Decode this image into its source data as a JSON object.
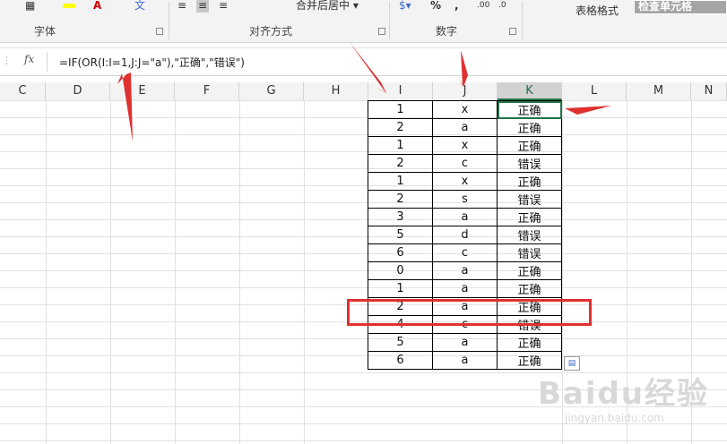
{
  "ribbon": {
    "groups": [
      "字体",
      "对齐方式",
      "数字"
    ],
    "merge_label": "合并后居中",
    "percent": "%",
    "comma": ",",
    "style_label": "表格格式",
    "check_cell": "检查单元格"
  },
  "formula_bar": {
    "fx": "fx",
    "formula": "=IF(OR(I:I=1,J:J=\"a\"),\"正确\",\"错误\")"
  },
  "columns": [
    "C",
    "D",
    "E",
    "F",
    "G",
    "H",
    "I",
    "J",
    "K",
    "L",
    "M",
    "N"
  ],
  "table": {
    "rows": [
      [
        "1",
        "x",
        "正确"
      ],
      [
        "2",
        "a",
        "正确"
      ],
      [
        "1",
        "x",
        "正确"
      ],
      [
        "2",
        "c",
        "错误"
      ],
      [
        "1",
        "x",
        "正确"
      ],
      [
        "2",
        "s",
        "错误"
      ],
      [
        "3",
        "a",
        "正确"
      ],
      [
        "5",
        "d",
        "错误"
      ],
      [
        "6",
        "c",
        "错误"
      ],
      [
        "0",
        "a",
        "正确"
      ],
      [
        "1",
        "a",
        "正确"
      ],
      [
        "2",
        "a",
        "正确"
      ],
      [
        "4",
        "c",
        "错误"
      ],
      [
        "5",
        "a",
        "正确"
      ],
      [
        "6",
        "a",
        "正确"
      ]
    ]
  },
  "watermark": {
    "text": "Baidu经验",
    "sub": "jingyan.baidu.com"
  },
  "colors": {
    "highlight": "#e03030",
    "selected": "#217346"
  }
}
